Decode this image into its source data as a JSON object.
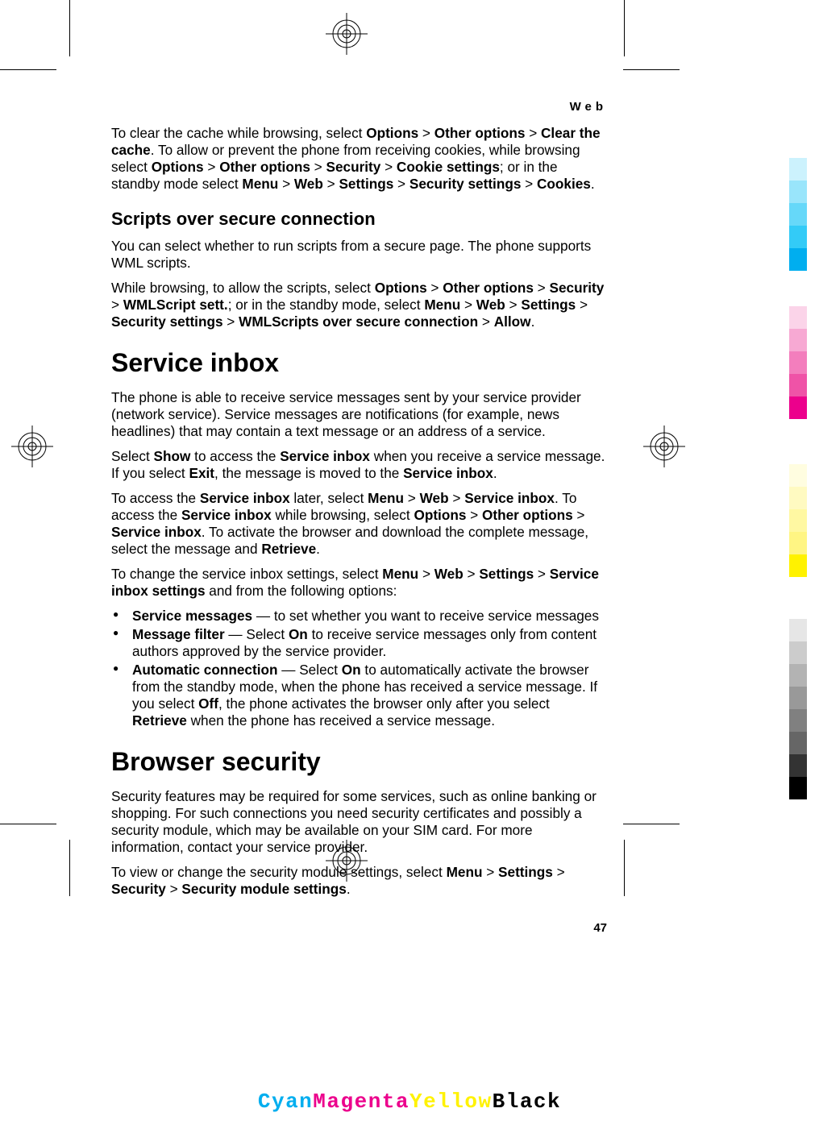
{
  "header": "Web",
  "page_number": "47",
  "footer": {
    "c": "Cyan",
    "m": "Magenta",
    "y": "Yellow",
    "k": "Black"
  },
  "colorbars": {
    "cyans": [
      "#CCF2FD",
      "#99E5FB",
      "#66D8F9",
      "#33CBF7",
      "#00AEEF"
    ],
    "magentas": [
      "#FBD4E9",
      "#F7A9D3",
      "#F37EBD",
      "#EF53A7",
      "#EC008C"
    ],
    "yellows": [
      "#FFFDE0",
      "#FFFAC1",
      "#FFF8A2",
      "#FFF583",
      "#FFF200"
    ],
    "grays": [
      "#E6E6E6",
      "#CCCCCC",
      "#B3B3B3",
      "#999999",
      "#808080",
      "#666666",
      "#333333",
      "#000000"
    ]
  },
  "p1": {
    "t1": "To clear the cache while browsing, select ",
    "b1": "Options",
    "s1": " > ",
    "b2": "Other options",
    "s2": " > ",
    "b3": "Clear the cache",
    "t2": ". To allow or prevent the phone from receiving cookies, while browsing select ",
    "b4": "Options",
    "s3": " > ",
    "b5": "Other options",
    "s4": " > ",
    "b6": "Security",
    "s5": " > ",
    "b7": "Cookie settings",
    "t3": "; or in the standby mode select ",
    "b8": "Menu",
    "s6": " > ",
    "b9": "Web",
    "s7": " > ",
    "b10": "Settings",
    "s8": " > ",
    "b11": "Security settings",
    "s9": " > ",
    "b12": "Cookies",
    "t4": "."
  },
  "h2_scripts": "Scripts over secure connection",
  "p2": "You can select whether to run scripts from a secure page. The phone supports WML scripts.",
  "p3": {
    "t1": "While browsing, to allow the scripts, select ",
    "b1": "Options",
    "s1": " > ",
    "b2": "Other options",
    "s2": " > ",
    "b3": "Security",
    "s3": " > ",
    "b4": "WMLScript sett.",
    "t2": "; or in the standby mode, select ",
    "b5": "Menu",
    "s4": " > ",
    "b6": "Web",
    "s5": " > ",
    "b7": "Settings",
    "s6": " > ",
    "b8": "Security settings",
    "s7": " > ",
    "b9": "WMLScripts over secure connection",
    "s8": " > ",
    "b10": "Allow",
    "t3": "."
  },
  "h1_inbox": "Service inbox",
  "p4": "The phone is able to receive service messages sent by your service provider (network service). Service messages are notifications (for example, news headlines) that may contain a text message or an address of a service.",
  "p5": {
    "t1": "Select ",
    "b1": "Show",
    "t2": " to access the ",
    "b2": "Service inbox",
    "t3": " when you receive a service message. If you select ",
    "b3": "Exit",
    "t4": ", the message is moved to the ",
    "b4": "Service inbox",
    "t5": "."
  },
  "p6": {
    "t1": "To access the ",
    "b1": "Service inbox",
    "t2": " later, select ",
    "b2": "Menu",
    "s1": " > ",
    "b3": "Web",
    "s2": " > ",
    "b4": "Service inbox",
    "t3": ". To access the ",
    "b5": "Service inbox",
    "t4": " while browsing, select ",
    "b6": "Options",
    "s3": " > ",
    "b7": "Other options",
    "s4": " > ",
    "b8": "Service inbox",
    "t5": ". To activate the browser and download the complete message, select the message and ",
    "b9": "Retrieve",
    "t6": "."
  },
  "p7": {
    "t1": "To change the service inbox settings, select ",
    "b1": "Menu",
    "s1": " > ",
    "b2": "Web",
    "s2": " > ",
    "b3": "Settings",
    "s3": " > ",
    "b4": "Service inbox settings",
    "t2": " and from the following options:"
  },
  "li1": {
    "b1": "Service messages",
    "t1": " — to set whether you want to receive service messages"
  },
  "li2": {
    "b1": "Message filter",
    "t1": " — Select ",
    "b2": "On",
    "t2": " to receive service messages only from content authors approved by the service provider."
  },
  "li3": {
    "b1": "Automatic connection",
    "t1": " — Select ",
    "b2": "On",
    "t2": " to automatically activate the browser from the standby mode, when the phone has received a service message. If you select ",
    "b3": "Off",
    "t3": ", the phone activates the browser only after you select ",
    "b4": "Retrieve",
    "t4": " when the phone has received a service message."
  },
  "h1_browser": "Browser security",
  "p8": "Security features may be required for some services, such as online banking or shopping. For such connections you need security certificates and possibly a security module, which may be available on your SIM card. For more information, contact your service provider.",
  "p9": {
    "t1": "To view or change the security module settings, select ",
    "b1": "Menu",
    "s1": " > ",
    "b2": "Settings",
    "s2": " > ",
    "b3": "Security",
    "s3": " > ",
    "b4": "Security module settings",
    "t2": "."
  }
}
